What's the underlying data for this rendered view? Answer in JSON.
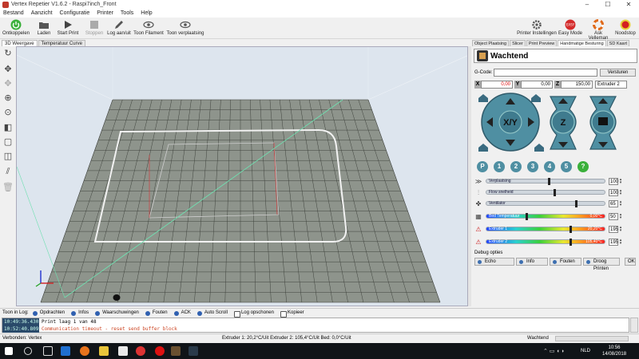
{
  "window": {
    "title": "Vertex Repetier V1.6.2 - Raspi7inch_Front",
    "minimize": "–",
    "maximize": "☐",
    "close": "✕"
  },
  "menu": [
    "Bestand",
    "Aanzicht",
    "Configuratie",
    "Printer",
    "Tools",
    "Help"
  ],
  "toolbar": {
    "disconnect": "Ontkoppelen",
    "load": "Laden",
    "start_print": "Start Print",
    "stop": "Stoppen",
    "log": "Log aan/uit",
    "show_filament": "Toon Filament",
    "show_travel": "Toon verplaatsing",
    "printer_settings": "Printer Instellingen",
    "easy_mode": "Easy Mode",
    "ask_velleman": "Ask Velleman",
    "emergency": "Noodstop",
    "easy_badge": "EASY"
  },
  "left_tabs": [
    "3D Weergave",
    "Temperatuur Curve"
  ],
  "right_tabs": [
    "Object Plaatsing",
    "Slicer",
    "Print Preview",
    "Handmatige Besturing",
    "SD Kaart"
  ],
  "control": {
    "status": "Wachtend",
    "gcode_label": "G-Code:",
    "gcode_value": "",
    "send_button": "Versturen",
    "x_label": "X",
    "x_value": "0,00",
    "y_label": "Y",
    "y_value": "0,00",
    "z_label": "Z",
    "z_value": "150,00",
    "extruder_select": "Extruder 2",
    "jog_xy": "X/Y",
    "jog_z": "Z",
    "presets": [
      "P",
      "1",
      "2",
      "3",
      "4",
      "5",
      "?"
    ]
  },
  "sliders": [
    {
      "label": "Verplaatsing",
      "value": "100",
      "fraction": 0.52
    },
    {
      "label": "Flow snelheid",
      "value": "100",
      "fraction": 0.57
    },
    {
      "label": "Ventilator",
      "value": "65",
      "fraction": 0.75
    }
  ],
  "temps": [
    {
      "label": "Bed Temperatuur",
      "reading": "0,00°C",
      "value": "50",
      "fraction": 0.33
    },
    {
      "label": "Extruder 1",
      "reading": "20,20°C",
      "value": "195",
      "fraction": 0.7
    },
    {
      "label": "Extruder 2",
      "reading": "105,40°C",
      "value": "195",
      "fraction": 0.7
    }
  ],
  "debug": {
    "label": "Debug opties",
    "buttons": [
      "Echo",
      "Info",
      "Fouten",
      "Droog Printen"
    ],
    "ok": "OK"
  },
  "log": {
    "title": "Toon in Log:",
    "filters": [
      "Opdrachten",
      "Infos",
      "Waarschuwingen",
      "Fouten",
      "ACK",
      "Auto Scroll",
      "Log opschonen",
      "Kopieer"
    ],
    "lines": [
      {
        "time": "10:49:36.430",
        "text": "Print laag 1 van 48",
        "error": false
      },
      {
        "time": "10:52:40.809",
        "text": "Communication timeout - reset send buffer block",
        "error": true
      }
    ]
  },
  "status_bar": {
    "connection": "Verbonden: Vertex",
    "temps": "Extruder 1: 20,2°C/Uit Extruder 2: 105,4°C/Uit Bed: 0,0°C/Uit",
    "state": "Wachtend"
  },
  "taskbar": {
    "time": "10:56",
    "date": "14/08/2018",
    "lang": "NLD"
  }
}
